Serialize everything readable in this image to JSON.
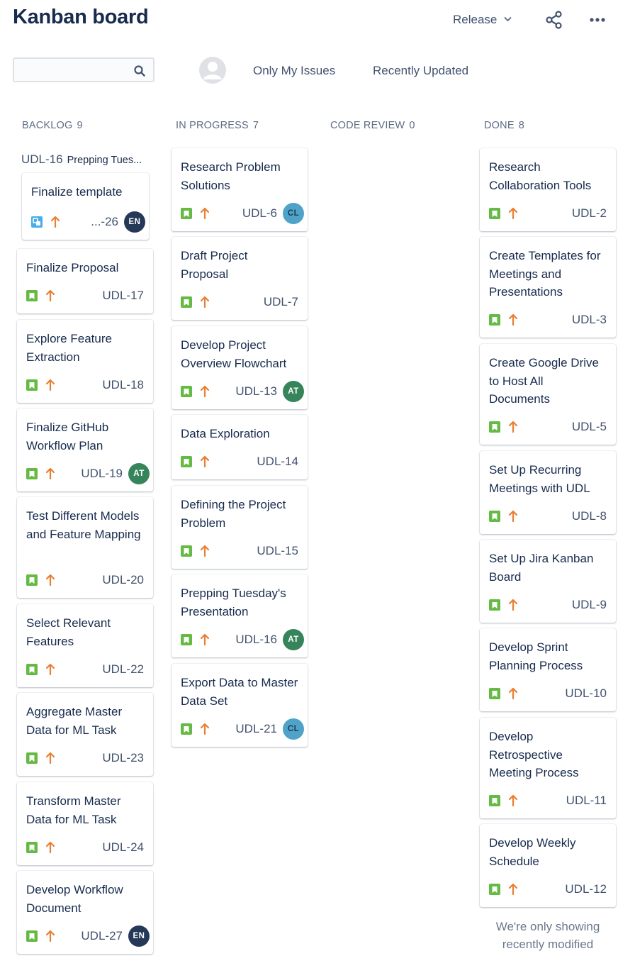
{
  "header": {
    "title": "Kanban board",
    "release_label": "Release",
    "share_icon": "share-icon",
    "more_icon": "more-icon"
  },
  "filters": {
    "search_value": "",
    "search_placeholder": "",
    "only_my_issues": "Only My Issues",
    "recently_updated": "Recently Updated"
  },
  "colors": {
    "story": "#65ba43",
    "subtask": "#4bade8",
    "priority_high": "#e97f33",
    "avatar_en": "#253858",
    "avatar_at": "#36845a",
    "avatar_cl": "#4fa3c8"
  },
  "columns": [
    {
      "name": "BACKLOG",
      "count": "9"
    },
    {
      "name": "IN PROGRESS",
      "count": "7"
    },
    {
      "name": "CODE REVIEW",
      "count": "0"
    },
    {
      "name": "DONE",
      "count": "8"
    }
  ],
  "backlog": {
    "epic_key": "UDL-16",
    "epic_title": "Prepping Tues...",
    "subtask": {
      "title": "Finalize template",
      "key": "...-26",
      "avatar": "EN"
    },
    "cards": [
      {
        "title": "Finalize Proposal",
        "key": "UDL-17"
      },
      {
        "title": "Explore Feature Extraction",
        "key": "UDL-18"
      },
      {
        "title": "Finalize GitHub Workflow Plan",
        "key": "UDL-19",
        "avatar": "AT"
      },
      {
        "title": "Test Different Models and Feature Mapping",
        "key": "UDL-20"
      },
      {
        "title": "Select Relevant Features",
        "key": "UDL-22"
      },
      {
        "title": "Aggregate Master Data for ML Task",
        "key": "UDL-23"
      },
      {
        "title": "Transform Master Data for ML Task",
        "key": "UDL-24"
      },
      {
        "title": "Develop Workflow Document",
        "key": "UDL-27",
        "avatar": "EN"
      }
    ]
  },
  "in_progress": {
    "cards": [
      {
        "title": "Research Problem Solutions",
        "key": "UDL-6",
        "avatar": "CL"
      },
      {
        "title": "Draft Project Proposal",
        "key": "UDL-7"
      },
      {
        "title": "Develop Project Overview Flowchart",
        "key": "UDL-13",
        "avatar": "AT"
      },
      {
        "title": "Data Exploration",
        "key": "UDL-14"
      },
      {
        "title": "Defining the Project Problem",
        "key": "UDL-15"
      },
      {
        "title": "Prepping Tuesday's Presentation",
        "key": "UDL-16",
        "avatar": "AT"
      },
      {
        "title": "Export Data to Master Data Set",
        "key": "UDL-21",
        "avatar": "CL"
      }
    ]
  },
  "done": {
    "cards": [
      {
        "title": "Research Collaboration Tools",
        "key": "UDL-2"
      },
      {
        "title": "Create Templates for Meetings and Presentations",
        "key": "UDL-3"
      },
      {
        "title": "Create Google Drive to Host All Documents",
        "key": "UDL-5"
      },
      {
        "title": "Set Up Recurring Meetings with UDL",
        "key": "UDL-8"
      },
      {
        "title": "Set Up Jira Kanban Board",
        "key": "UDL-9"
      },
      {
        "title": "Develop Sprint Planning Process",
        "key": "UDL-10"
      },
      {
        "title": "Develop Retrospective Meeting Process",
        "key": "UDL-11"
      },
      {
        "title": "Develop Weekly Schedule",
        "key": "UDL-12"
      }
    ],
    "note": "We're only showing recently modified"
  }
}
